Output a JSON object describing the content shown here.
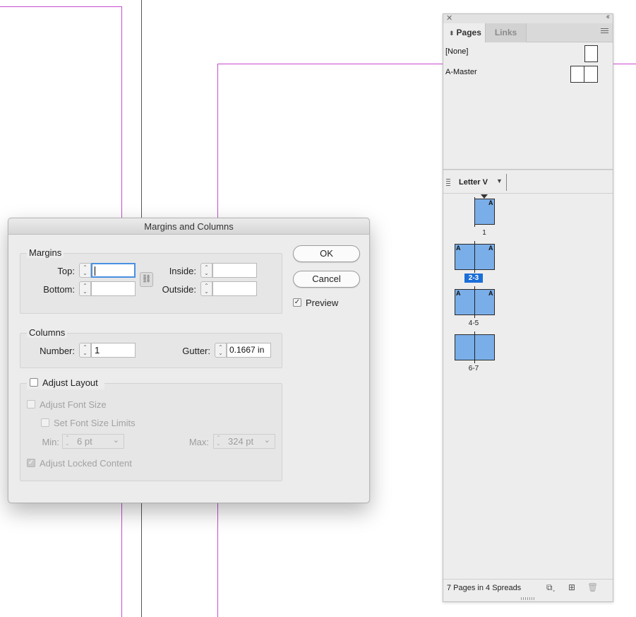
{
  "pages_panel": {
    "tabs": [
      "Pages",
      "Links"
    ],
    "masters": [
      {
        "label": "[None]"
      },
      {
        "label": "A-Master"
      }
    ],
    "page_size": "Letter V",
    "spreads": [
      {
        "label": "1",
        "master_letters": [
          "A"
        ]
      },
      {
        "label": "2-3",
        "master_letters": [
          "A",
          "A"
        ],
        "selected": true
      },
      {
        "label": "4-5",
        "master_letters": [
          "A",
          "A"
        ]
      },
      {
        "label": "6-7",
        "master_letters": []
      }
    ],
    "status": "7 Pages in 4 Spreads",
    "footer_icons": [
      "edit-page-size-icon",
      "new-page-icon",
      "trash-icon"
    ]
  },
  "dialog": {
    "title": "Margins and Columns",
    "margins": {
      "title": "Margins",
      "top_label": "Top:",
      "top_value": "",
      "bottom_label": "Bottom:",
      "bottom_value": "",
      "inside_label": "Inside:",
      "inside_value": "",
      "outside_label": "Outside:",
      "outside_value": ""
    },
    "columns": {
      "title": "Columns",
      "number_label": "Number:",
      "number_value": "1",
      "gutter_label": "Gutter:",
      "gutter_value": "0.1667 in"
    },
    "adjust_layout": {
      "label": "Adjust Layout",
      "checked": false,
      "adjust_font_size": "Adjust Font Size",
      "set_font_size_limits": "Set Font Size Limits",
      "min_label": "Min:",
      "min_value": "6 pt",
      "max_label": "Max:",
      "max_value": "324 pt",
      "adjust_locked_content": "Adjust Locked Content"
    },
    "ok_label": "OK",
    "cancel_label": "Cancel",
    "preview_label": "Preview",
    "preview_checked": true
  },
  "colors": {
    "guide": "#c84ad0",
    "page_fill": "#7aaee8",
    "selected_label": "#1a6ed8",
    "focus_ring": "#4a90e2"
  }
}
